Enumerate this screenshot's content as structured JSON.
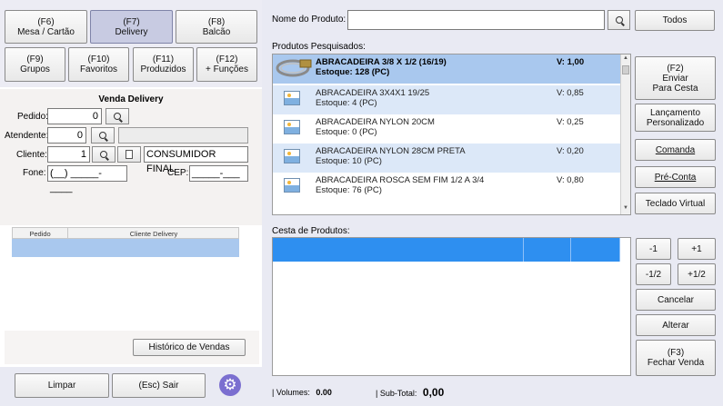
{
  "top_buttons": [
    {
      "key": "(F6)",
      "label": "Mesa / Cartão"
    },
    {
      "key": "(F7)",
      "label": "Delivery"
    },
    {
      "key": "(F8)",
      "label": "Balcão"
    },
    {
      "key": "(F9)",
      "label": "Grupos"
    },
    {
      "key": "(F10)",
      "label": "Favoritos"
    },
    {
      "key": "(F11)",
      "label": "Produzidos"
    },
    {
      "key": "(F12)",
      "label": "+ Funções"
    }
  ],
  "venda": {
    "title": "Venda Delivery",
    "pedido_label": "Pedido:",
    "pedido_value": "0",
    "atendente_label": "Atendente:",
    "atendente_value": "0",
    "cliente_label": "Cliente:",
    "cliente_value": "1",
    "cliente_nome": "CONSUMIDOR FINAL",
    "fone_label": "Fone:",
    "fone_value": "(__) _____-____",
    "cep_label": "CEP:",
    "cep_value": "_____-___"
  },
  "orders_table": {
    "headers": [
      "Pedido",
      "Cliente Delivery"
    ]
  },
  "historico_label": "Histórico de Vendas",
  "bottom_left": {
    "limpar": "Limpar",
    "sair": "(Esc) Sair"
  },
  "search": {
    "label": "Nome do Produto:",
    "value": "",
    "todos": "Todos"
  },
  "produtos_label": "Produtos Pesquisados:",
  "produtos": [
    {
      "name": "ABRACADEIRA 3/8 X 1/2 (16/19)",
      "estoque": "Estoque: 128 (PC)",
      "valor": "V: 1,00",
      "selected": true
    },
    {
      "name": "ABRACADEIRA 3X4X1 19/25",
      "estoque": "Estoque: 4 (PC)",
      "valor": "V: 0,85",
      "selected": false
    },
    {
      "name": "ABRACADEIRA NYLON 20CM",
      "estoque": "Estoque: 0 (PC)",
      "valor": "V: 0,25",
      "selected": false
    },
    {
      "name": "ABRACADEIRA NYLON 28CM PRETA",
      "estoque": "Estoque: 10 (PC)",
      "valor": "V: 0,20",
      "selected": false
    },
    {
      "name": "ABRACADEIRA ROSCA SEM FIM 1/2 A 3/4",
      "estoque": "Estoque: 76 (PC)",
      "valor": "V: 0,80",
      "selected": false
    }
  ],
  "side_buttons": {
    "enviar": "(F2)\nEnviar\nPara Cesta",
    "lancamento": "Lançamento\nPersonalizado",
    "comanda": "Comanda",
    "preconta": "Pré-Conta",
    "teclado": "Teclado Virtual"
  },
  "cesta_label": "Cesta de Produtos:",
  "qty_buttons": [
    "-1",
    "+1",
    "-1/2",
    "+1/2"
  ],
  "cancelar": "Cancelar",
  "alterar": "Alterar",
  "fechar": "(F3)\nFechar Venda",
  "footer": {
    "volumes_label": "| Volumes:",
    "volumes_value": "0.00",
    "subtotal_label": "| Sub-Total:",
    "subtotal_value": "0,00"
  },
  "colors": {
    "accent_blue": "#2e8ff0",
    "selected_row": "#a9c8ee",
    "alt_row": "#dce8f8",
    "right_bg": "#e9eaf3"
  }
}
